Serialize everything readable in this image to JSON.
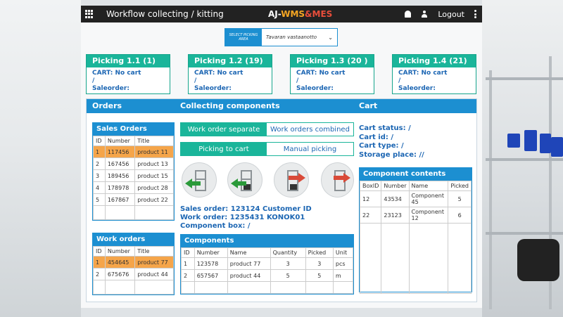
{
  "header": {
    "title": "Workflow collecting / kitting",
    "brand_prefix": "AJ-",
    "brand_wms": "WMS",
    "brand_amp": "&",
    "brand_mes": "MES",
    "logout": "Logout"
  },
  "area_select": {
    "label": "SELECT PICKING AREA",
    "value": "Tavaran vastaanotto"
  },
  "pickings": [
    {
      "title": "Picking 1.1 (1)",
      "cart": "CART: No cart",
      "slash": "/",
      "saleorder": "Saleorder:"
    },
    {
      "title": "Picking 1.2 (19)",
      "cart": "CART: No cart",
      "slash": "/",
      "saleorder": "Saleorder:"
    },
    {
      "title": "Picking 1.3 (20 )",
      "cart": "CART: No cart",
      "slash": "/",
      "saleorder": "Saleorder:"
    },
    {
      "title": "Picking 1.4 (21)",
      "cart": "CART: No cart",
      "slash": "/",
      "saleorder": "Saleorder:"
    }
  ],
  "section_heads": {
    "orders": "Orders",
    "collecting": "Collecting components",
    "cart": "Cart"
  },
  "sales_orders": {
    "title": "Sales Orders",
    "columns": [
      "ID",
      "Number",
      "Title"
    ],
    "rows": [
      [
        "1",
        "117456",
        "product 11"
      ],
      [
        "2",
        "167456",
        "product 13"
      ],
      [
        "3",
        "189456",
        "product 15"
      ],
      [
        "4",
        "178978",
        "product 28"
      ],
      [
        "5",
        "167867",
        "product 22"
      ]
    ]
  },
  "work_orders": {
    "title": "Work orders",
    "columns": [
      "ID",
      "Number",
      "Title"
    ],
    "rows": [
      [
        "1",
        "454645",
        "product 77"
      ],
      [
        "2",
        "675676",
        "product 44"
      ]
    ]
  },
  "mode_toggle": {
    "separate": "Work order separate",
    "combined": "Work orders combined"
  },
  "pick_toggle": {
    "to_cart": "Picking to cart",
    "manual": "Manual picking"
  },
  "order_info": {
    "sales_order": "Sales order: 123124 Customer ID",
    "work_order": "Work order: 1235431 KONOK01",
    "component_box": "Component box: /"
  },
  "components": {
    "title": "Components",
    "columns": [
      "ID",
      "Number",
      "Name",
      "Quantity",
      "Picked",
      "Unit"
    ],
    "rows": [
      [
        "1",
        "123578",
        "product 77",
        "3",
        "3",
        "pcs"
      ],
      [
        "2",
        "657567",
        "product 44",
        "5",
        "5",
        "m"
      ]
    ]
  },
  "cart_info": {
    "status": "Cart status: /",
    "id": "Cart id: /",
    "type": "Cart type: /",
    "storage": "Storage place: //"
  },
  "component_contents": {
    "title": "Component contents",
    "columns": [
      "BoxID",
      "Number",
      "Name",
      "Picked"
    ],
    "rows": [
      [
        "12",
        "43534",
        "Component 45",
        "5"
      ],
      [
        "22",
        "23123",
        "Component 12",
        "6"
      ]
    ]
  },
  "colors": {
    "accent_blue": "#1c8fd1",
    "accent_teal": "#1ab59a",
    "selected_row": "#f5a54a",
    "brand_orange": "#f6a623",
    "brand_red": "#e94e3b"
  },
  "icons": [
    "grid-icon",
    "bell-icon",
    "user-icon",
    "more-icon",
    "cart-unload-icon",
    "cart-unload-box-icon",
    "cart-load-box-icon",
    "cart-load-icon"
  ]
}
